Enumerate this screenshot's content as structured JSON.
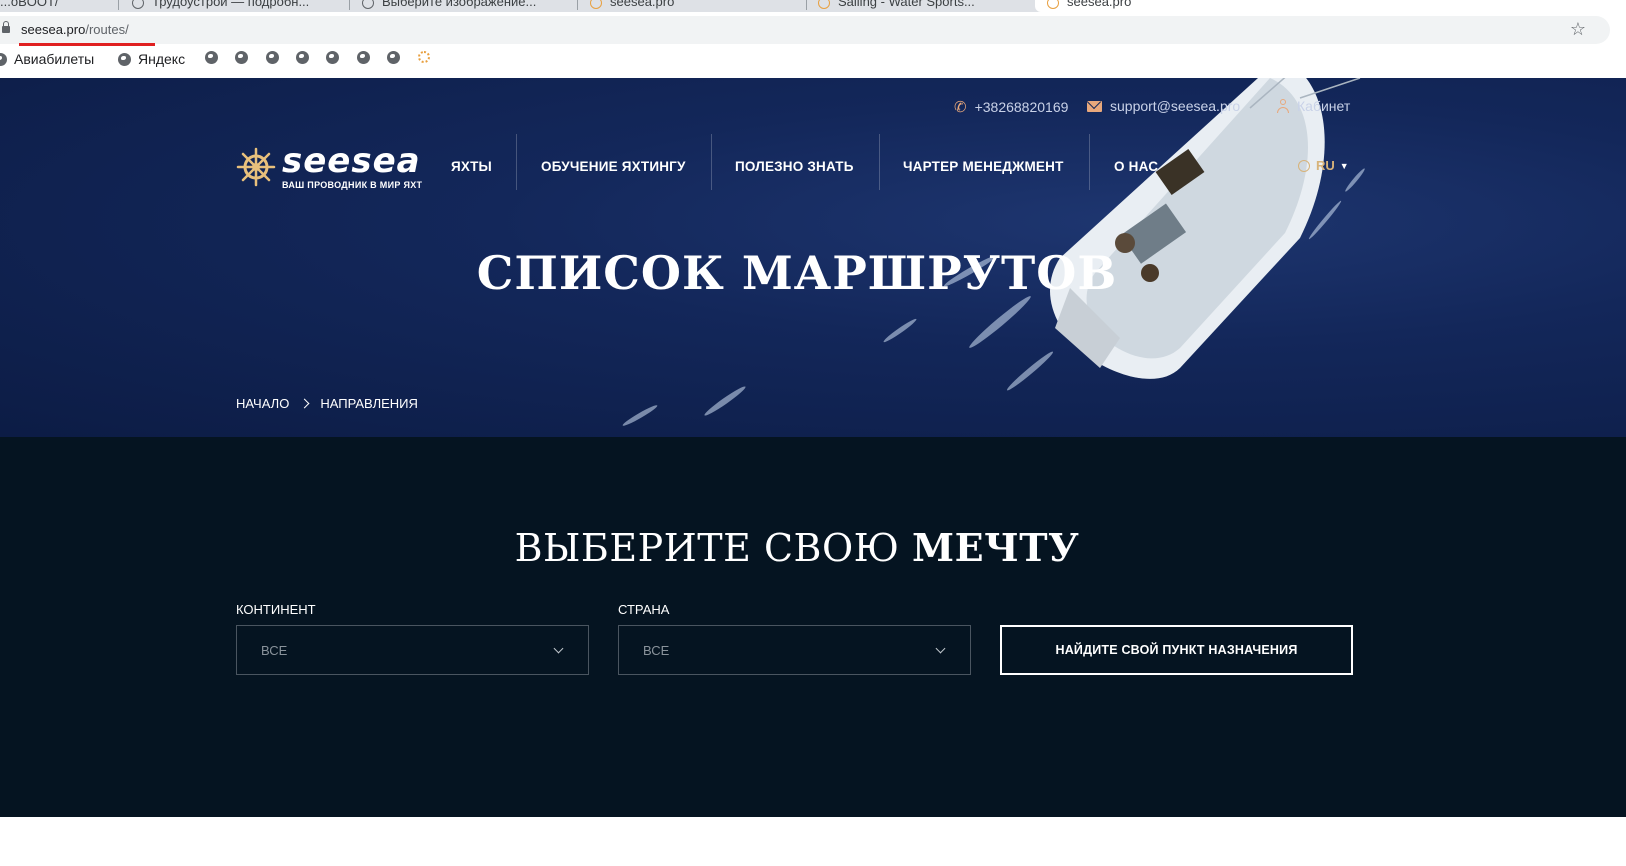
{
  "browser": {
    "tabs": [
      {
        "title": "...oBOOT/"
      },
      {
        "title": "Трудоустрой — подробн..."
      },
      {
        "title": "Выберите изображение..."
      },
      {
        "title": "seesea.pro"
      },
      {
        "title": "Sailing - Water Sports..."
      },
      {
        "title": "seesea.pro"
      }
    ],
    "url_domain": "seesea.pro",
    "url_path": "/routes/",
    "bookmarks": [
      {
        "label": "Авиабилеты",
        "icon": "globe-icon"
      },
      {
        "label": "Яндекс",
        "icon": "globe-icon"
      }
    ],
    "bookmark_icon_count_label": ""
  },
  "header": {
    "phone": "+38268820169",
    "email": "support@seesea.pro",
    "cabinet": "Кабинет",
    "logo_name": "seesea",
    "logo_tagline": "ВАШ ПРОВОДНИК В МИР ЯХТ",
    "nav": [
      {
        "label": "ЯХТЫ"
      },
      {
        "label": "ОБУЧЕНИЕ ЯХТИНГУ"
      },
      {
        "label": "ПОЛЕЗНО ЗНАТЬ"
      },
      {
        "label": "ЧАРТЕР МЕНЕДЖМЕНТ"
      },
      {
        "label": "О НАС"
      }
    ],
    "lang": "RU"
  },
  "hero": {
    "title": "СПИСОК МАРШРУТОВ",
    "breadcrumbs": [
      "НАЧАЛО",
      "НАПРАВЛЕНИЯ"
    ]
  },
  "search": {
    "title_regular": "ВЫБЕРИТЕ СВОЮ ",
    "title_bold": "МЕЧТУ",
    "continent_label": "КОНТИНЕНТ",
    "continent_value": "ВСЕ",
    "country_label": "СТРАНА",
    "country_value": "ВСЕ",
    "button_label": "НАЙДИТЕ СВОЙ ПУНКТ НАЗНАЧЕНИЯ"
  },
  "colors": {
    "hero_bg": "#13275a",
    "search_bg": "#051421",
    "accent": "#e8a87c",
    "url_underline": "#e02020"
  }
}
